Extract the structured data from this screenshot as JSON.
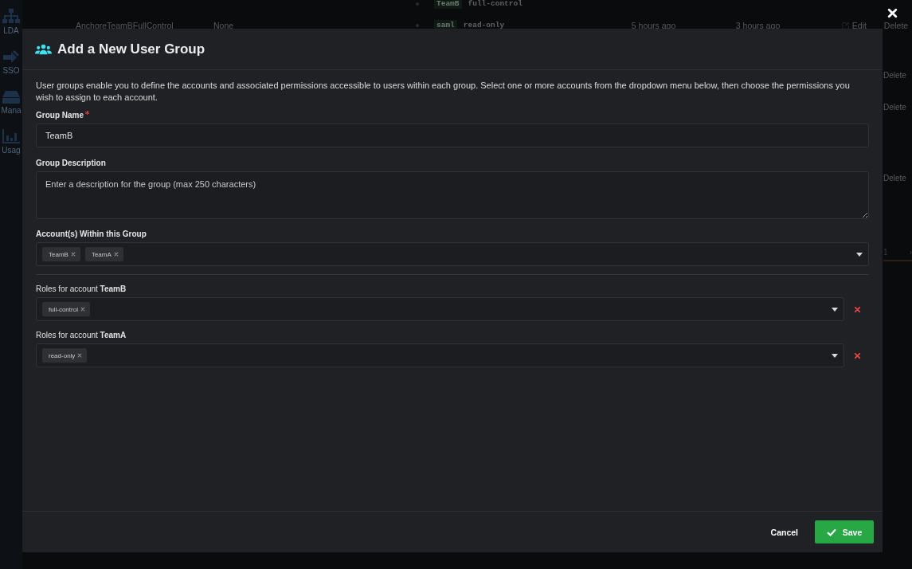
{
  "background": {
    "sidebar": [
      {
        "label": "LDA"
      },
      {
        "label": "SSO"
      },
      {
        "label": "Mana"
      },
      {
        "label": "Usag"
      }
    ],
    "rows": [
      {
        "cells": [
          "",
          "",
          "TeamB",
          "full-control",
          "",
          "",
          "",
          ""
        ]
      },
      {
        "cells": [
          "AnchoreTeamBFullControl",
          "None",
          "saml",
          "read-only",
          "5 hours ago",
          "3 hours ago",
          "Edit",
          "Delete"
        ]
      }
    ],
    "side_links": [
      "Delete",
      "Delete",
      "Delete"
    ],
    "pager": {
      "page": "1",
      "next": "›"
    }
  },
  "dialog": {
    "title": "Add a New User Group",
    "intro": "User groups enable you to define the accounts and associated permissions accessible to users within each group. Select one or more accounts from the dropdown menu below, then choose the permissions you wish to assign to each account.",
    "group_name": {
      "label": "Group Name",
      "required": true,
      "value": "TeamB"
    },
    "group_description": {
      "label": "Group Description",
      "placeholder": "Enter a description for the group (max 250 characters)"
    },
    "accounts": {
      "label": "Account(s) Within this Group",
      "selected": [
        "TeamB",
        "TeamA"
      ]
    },
    "role_groups": [
      {
        "label": "Roles for account **TeamB**",
        "roles": [
          "full-control"
        ]
      },
      {
        "label": "Roles for account **TeamA**",
        "roles": [
          "read-only"
        ]
      }
    ],
    "buttons": {
      "cancel": "Cancel",
      "save": "Save"
    }
  }
}
